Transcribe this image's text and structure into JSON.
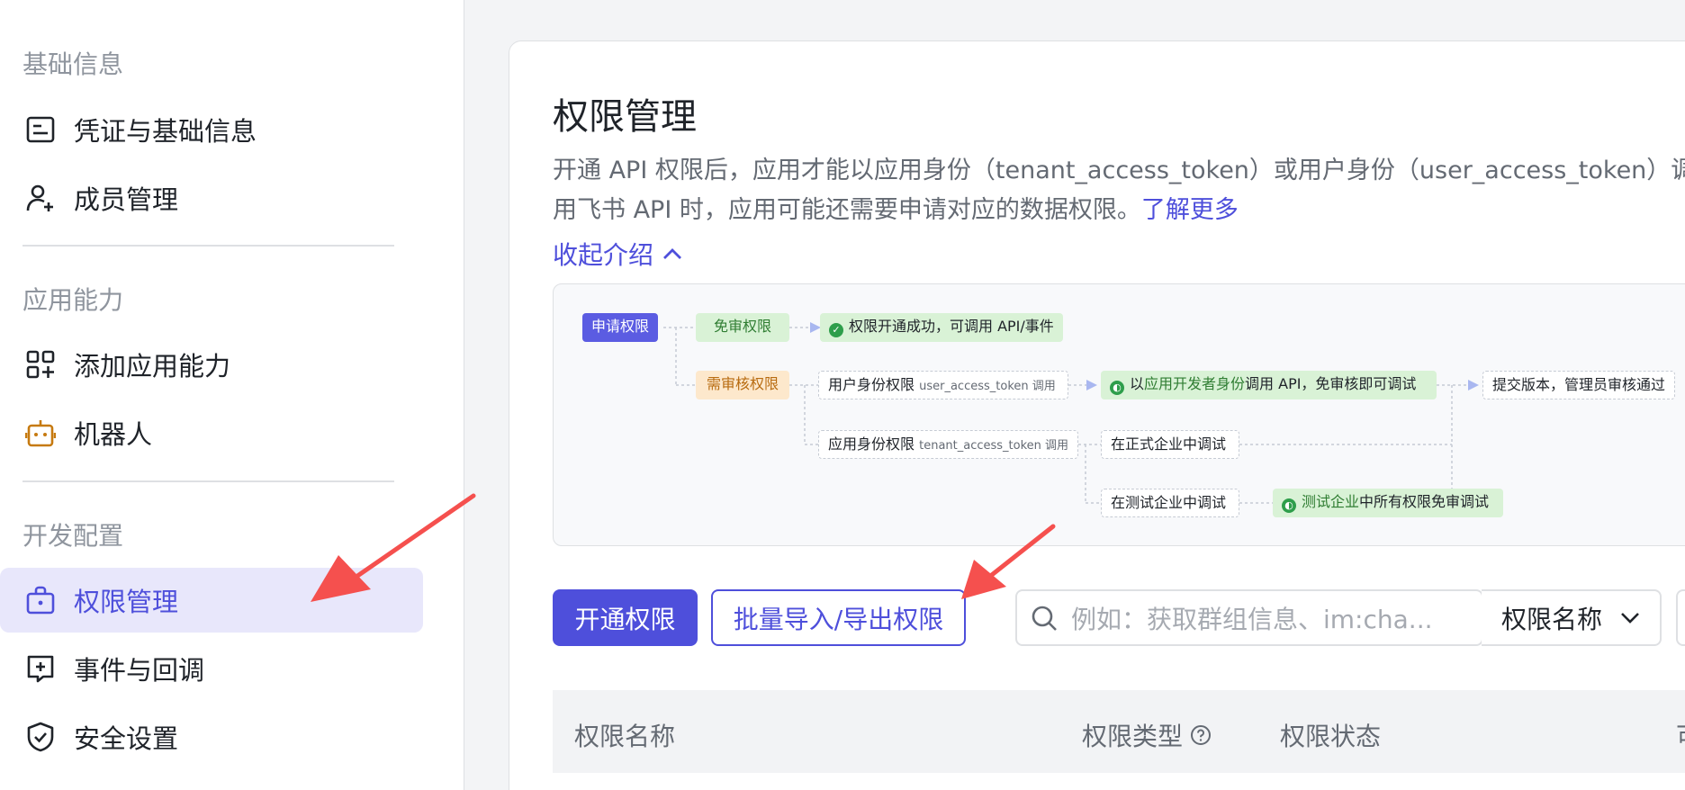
{
  "sidebar": {
    "groups": [
      {
        "title": "基础信息"
      },
      {
        "title": "应用能力"
      },
      {
        "title": "开发配置"
      }
    ],
    "items": [
      {
        "label": "凭证与基础信息",
        "icon": "credential-icon"
      },
      {
        "label": "成员管理",
        "icon": "add-member-icon"
      },
      {
        "label": "添加应用能力",
        "icon": "add-capability-icon"
      },
      {
        "label": "机器人",
        "icon": "robot-icon"
      },
      {
        "label": "权限管理",
        "icon": "permission-icon",
        "active": true
      },
      {
        "label": "事件与回调",
        "icon": "event-icon"
      },
      {
        "label": "安全设置",
        "icon": "shield-icon"
      }
    ]
  },
  "main": {
    "title": "权限管理",
    "desc_line1": "开通 API 权限后，应用才能以应用身份（tenant_access_token）或用户身份（user_access_token）调用",
    "desc_line2": "用飞书 API 时，应用可能还需要申请对应的数据权限。",
    "learn_more": "了解更多",
    "collapse_label": "收起介绍"
  },
  "diagram": {
    "apply": "申请权限",
    "free": "免审权限",
    "success": "权限开通成功，可调用 API/事件",
    "review": "需审核权限",
    "user_perm": "用户身份权限",
    "user_token": "user_access_token 调用",
    "dev_prefix": "以",
    "dev_hl": "应用开发者身份",
    "dev_suffix": "调用 API，免审核即可调试",
    "submit": "提交版本，管理员审核通过",
    "app_perm": "应用身份权限",
    "tenant_token": "tenant_access_token 调用",
    "formal": "在正式企业中调试",
    "test": "在测试企业中调试",
    "test_hl": "测试企业",
    "test_suffix": "中所有权限免审调试"
  },
  "toolbar": {
    "open_label": "开通权限",
    "batch_label": "批量导入/导出权限",
    "search_placeholder": "例如：获取群组信息、im:cha...",
    "select_value": "权限名称"
  },
  "table": {
    "columns": [
      "权限名称",
      "权限类型",
      "权限状态",
      "可"
    ]
  },
  "colors": {
    "accent": "#4e4fdb",
    "active_bg": "#e8e7fb",
    "arrow": "#f5504e"
  }
}
